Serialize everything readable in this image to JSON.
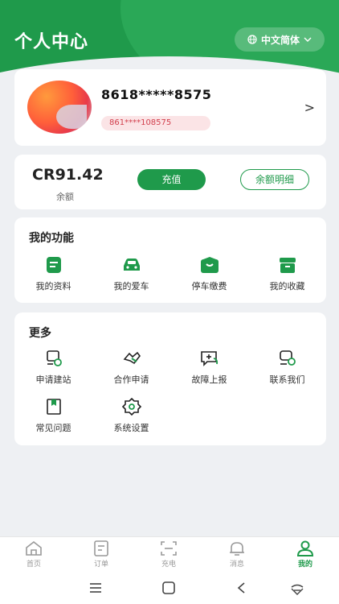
{
  "header": {
    "title": "个人中心",
    "language": "中文简体",
    "globe_icon": "globe-icon",
    "chevron_icon": "chevron-down-icon"
  },
  "profile": {
    "phone": "8618*****8575",
    "user_id": "861****108575",
    "arrow": ">"
  },
  "balance": {
    "amount": "CR91.42",
    "label": "余额",
    "recharge_label": "充值",
    "details_label": "余额明细"
  },
  "functions": {
    "title": "我的功能",
    "items": [
      {
        "label": "我的资料",
        "icon": "profile-doc-icon"
      },
      {
        "label": "我的爱车",
        "icon": "car-icon"
      },
      {
        "label": "停车缴费",
        "icon": "parking-payment-icon"
      },
      {
        "label": "我的收藏",
        "icon": "favorites-box-icon"
      }
    ]
  },
  "more": {
    "title": "更多",
    "items": [
      {
        "label": "申请建站",
        "icon": "station-apply-icon"
      },
      {
        "label": "合作申请",
        "icon": "handshake-icon"
      },
      {
        "label": "故障上报",
        "icon": "fault-report-icon"
      },
      {
        "label": "联系我们",
        "icon": "contact-icon"
      },
      {
        "label": "常见问题",
        "icon": "faq-book-icon"
      },
      {
        "label": "系统设置",
        "icon": "settings-gear-icon"
      }
    ]
  },
  "tabbar": {
    "items": [
      {
        "label": "首页",
        "icon": "home-icon",
        "active": false
      },
      {
        "label": "订单",
        "icon": "order-icon",
        "active": false
      },
      {
        "label": "充电",
        "icon": "scan-charge-icon",
        "active": false
      },
      {
        "label": "消息",
        "icon": "bell-icon",
        "active": false
      },
      {
        "label": "我的",
        "icon": "user-icon",
        "active": true
      }
    ]
  },
  "colors": {
    "brand": "#1f9a4b",
    "background": "#eef0f3",
    "id_badge_bg": "#fbe4e6",
    "id_badge_text": "#d2404e"
  }
}
